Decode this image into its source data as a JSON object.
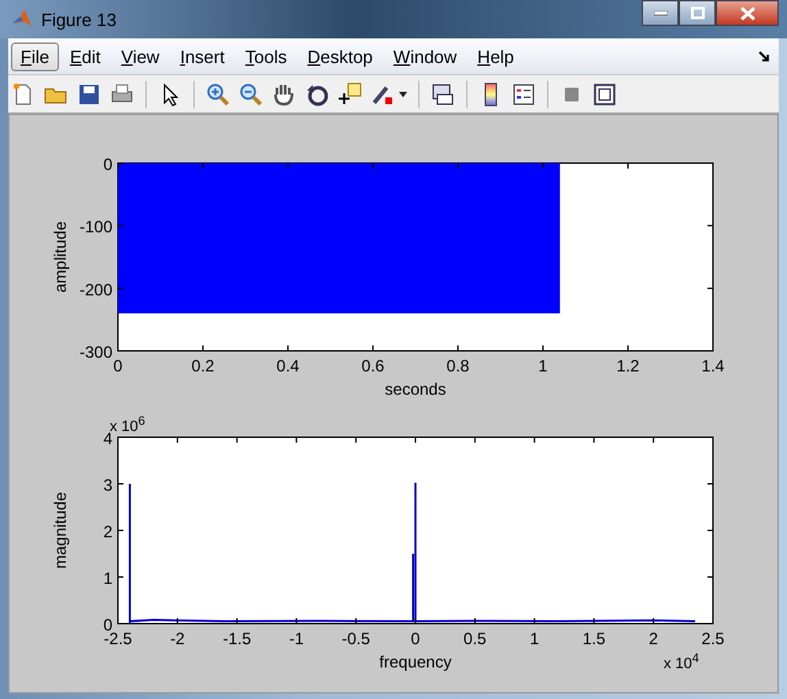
{
  "window": {
    "title": "Figure 13"
  },
  "menu": [
    {
      "label": "File",
      "selected": true
    },
    {
      "label": "Edit",
      "selected": false
    },
    {
      "label": "View",
      "selected": false
    },
    {
      "label": "Insert",
      "selected": false
    },
    {
      "label": "Tools",
      "selected": false
    },
    {
      "label": "Desktop",
      "selected": false
    },
    {
      "label": "Window",
      "selected": false
    },
    {
      "label": "Help",
      "selected": false
    }
  ],
  "plots": [
    {
      "chart_data": {
        "type": "area",
        "xlabel": "seconds",
        "ylabel": "amplitude",
        "x": [
          0,
          1.04
        ],
        "series": [
          {
            "color": "#0000ff",
            "values": [
              -240,
              -240
            ]
          }
        ],
        "xlim": [
          0,
          1.4
        ],
        "ylim": [
          -300,
          0
        ],
        "xticks": [
          {
            "value": 0,
            "label": "0"
          },
          {
            "value": 0.2,
            "label": "0.2"
          },
          {
            "value": 0.4,
            "label": "0.4"
          },
          {
            "value": 0.6,
            "label": "0.6"
          },
          {
            "value": 0.8,
            "label": "0.8"
          },
          {
            "value": 1,
            "label": "1"
          },
          {
            "value": 1.2,
            "label": "1.2"
          },
          {
            "value": 1.4,
            "label": "1.4"
          }
        ],
        "yticks": [
          {
            "value": -300,
            "label": "-300"
          },
          {
            "value": -200,
            "label": "-200"
          },
          {
            "value": -100,
            "label": "-100"
          },
          {
            "value": 0,
            "label": "0"
          }
        ]
      }
    },
    {
      "y_multiplier": "x 10$^{6}$",
      "x_multiplier": "x 10$^{4}$",
      "chart_data": {
        "type": "line",
        "xlabel": "frequency",
        "ylabel": "magnitude",
        "x": [
          -2.4,
          -2.4,
          -2.4,
          -2.2,
          -1.6,
          -0.8,
          -0.02,
          -0.02,
          -0.02,
          0,
          0,
          0,
          0.5,
          1.2,
          2.0,
          2.35
        ],
        "series": [
          {
            "color": "#0000cc",
            "values": [
              0,
              3,
              0.05,
              0.08,
              0.05,
              0.06,
              0.05,
              1.5,
              0.05,
              0.05,
              3.02,
              0.05,
              0.06,
              0.05,
              0.07,
              0.05
            ]
          }
        ],
        "xlim": [
          -2.5,
          2.5
        ],
        "ylim": [
          0,
          4
        ],
        "xticks": [
          {
            "value": -2.5,
            "label": "-2.5"
          },
          {
            "value": -2,
            "label": "-2"
          },
          {
            "value": -1.5,
            "label": "-1.5"
          },
          {
            "value": -1,
            "label": "-1"
          },
          {
            "value": -0.5,
            "label": "-0.5"
          },
          {
            "value": 0,
            "label": "0"
          },
          {
            "value": 0.5,
            "label": "0.5"
          },
          {
            "value": 1,
            "label": "1"
          },
          {
            "value": 1.5,
            "label": "1.5"
          },
          {
            "value": 2,
            "label": "2"
          },
          {
            "value": 2.5,
            "label": "2.5"
          }
        ],
        "yticks": [
          {
            "value": 0,
            "label": "0"
          },
          {
            "value": 1,
            "label": "1"
          },
          {
            "value": 2,
            "label": "2"
          },
          {
            "value": 3,
            "label": "3"
          },
          {
            "value": 4,
            "label": "4"
          }
        ]
      }
    }
  ]
}
